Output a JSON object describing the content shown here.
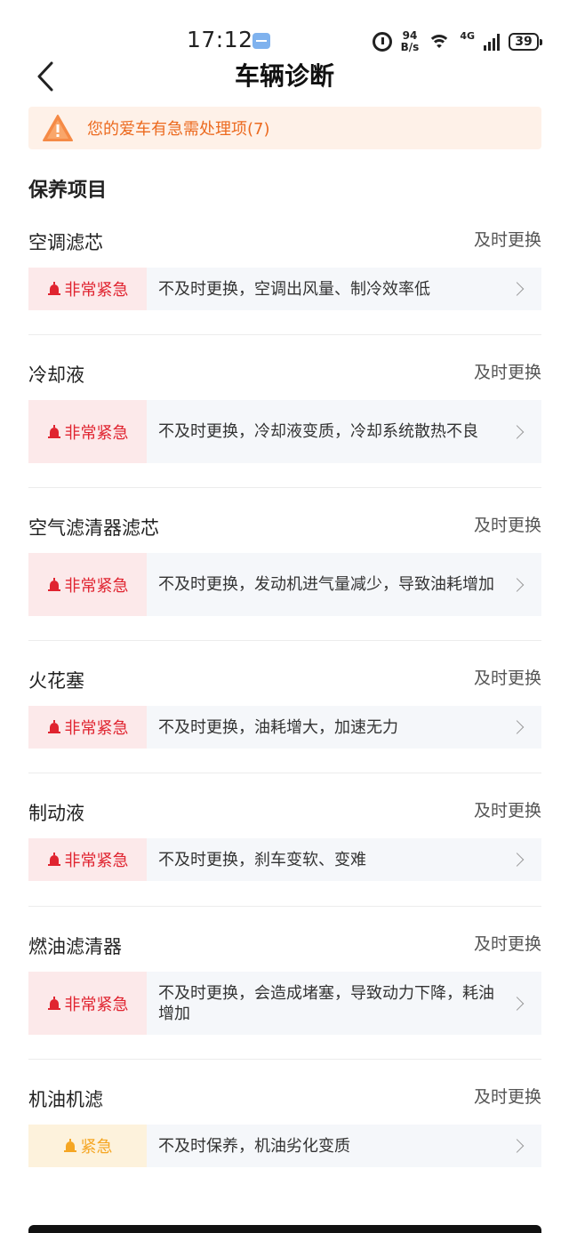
{
  "status_bar": {
    "time": "17:12",
    "speed_value": "94",
    "speed_unit": "B/s",
    "network": "4G",
    "battery": "39"
  },
  "header": {
    "title": "车辆诊断"
  },
  "alert": {
    "text": "您的爱车有急需处理项(7)",
    "color": "#ec6a1f"
  },
  "section": {
    "title": "保养项目"
  },
  "items": [
    {
      "name": "空调滤芯",
      "action": "及时更换",
      "urgency": "非常紧急",
      "level": "high",
      "desc": "不及时更换，空调出风量、制冷效率低"
    },
    {
      "name": "冷却液",
      "action": "及时更换",
      "urgency": "非常紧急",
      "level": "high",
      "desc": "不及时更换，冷却液变质，冷却系统散热不良"
    },
    {
      "name": "空气滤清器滤芯",
      "action": "及时更换",
      "urgency": "非常紧急",
      "level": "high",
      "desc": "不及时更换，发动机进气量减少，导致油耗增加"
    },
    {
      "name": "火花塞",
      "action": "及时更换",
      "urgency": "非常紧急",
      "level": "high",
      "desc": "不及时更换，油耗增大，加速无力"
    },
    {
      "name": "制动液",
      "action": "及时更换",
      "urgency": "非常紧急",
      "level": "high",
      "desc": "不及时更换，刹车变软、变难"
    },
    {
      "name": "燃油滤清器",
      "action": "及时更换",
      "urgency": "非常紧急",
      "level": "high",
      "desc": "不及时更换，会造成堵塞，导致动力下降，耗油增加"
    },
    {
      "name": "机油机滤",
      "action": "及时更换",
      "urgency": "紧急",
      "level": "mid",
      "desc": "不及时保养，机油劣化变质"
    }
  ],
  "colors": {
    "urgent_high": "#e02430",
    "urgent_mid": "#f5a623",
    "accent": "#ec6a1f"
  }
}
